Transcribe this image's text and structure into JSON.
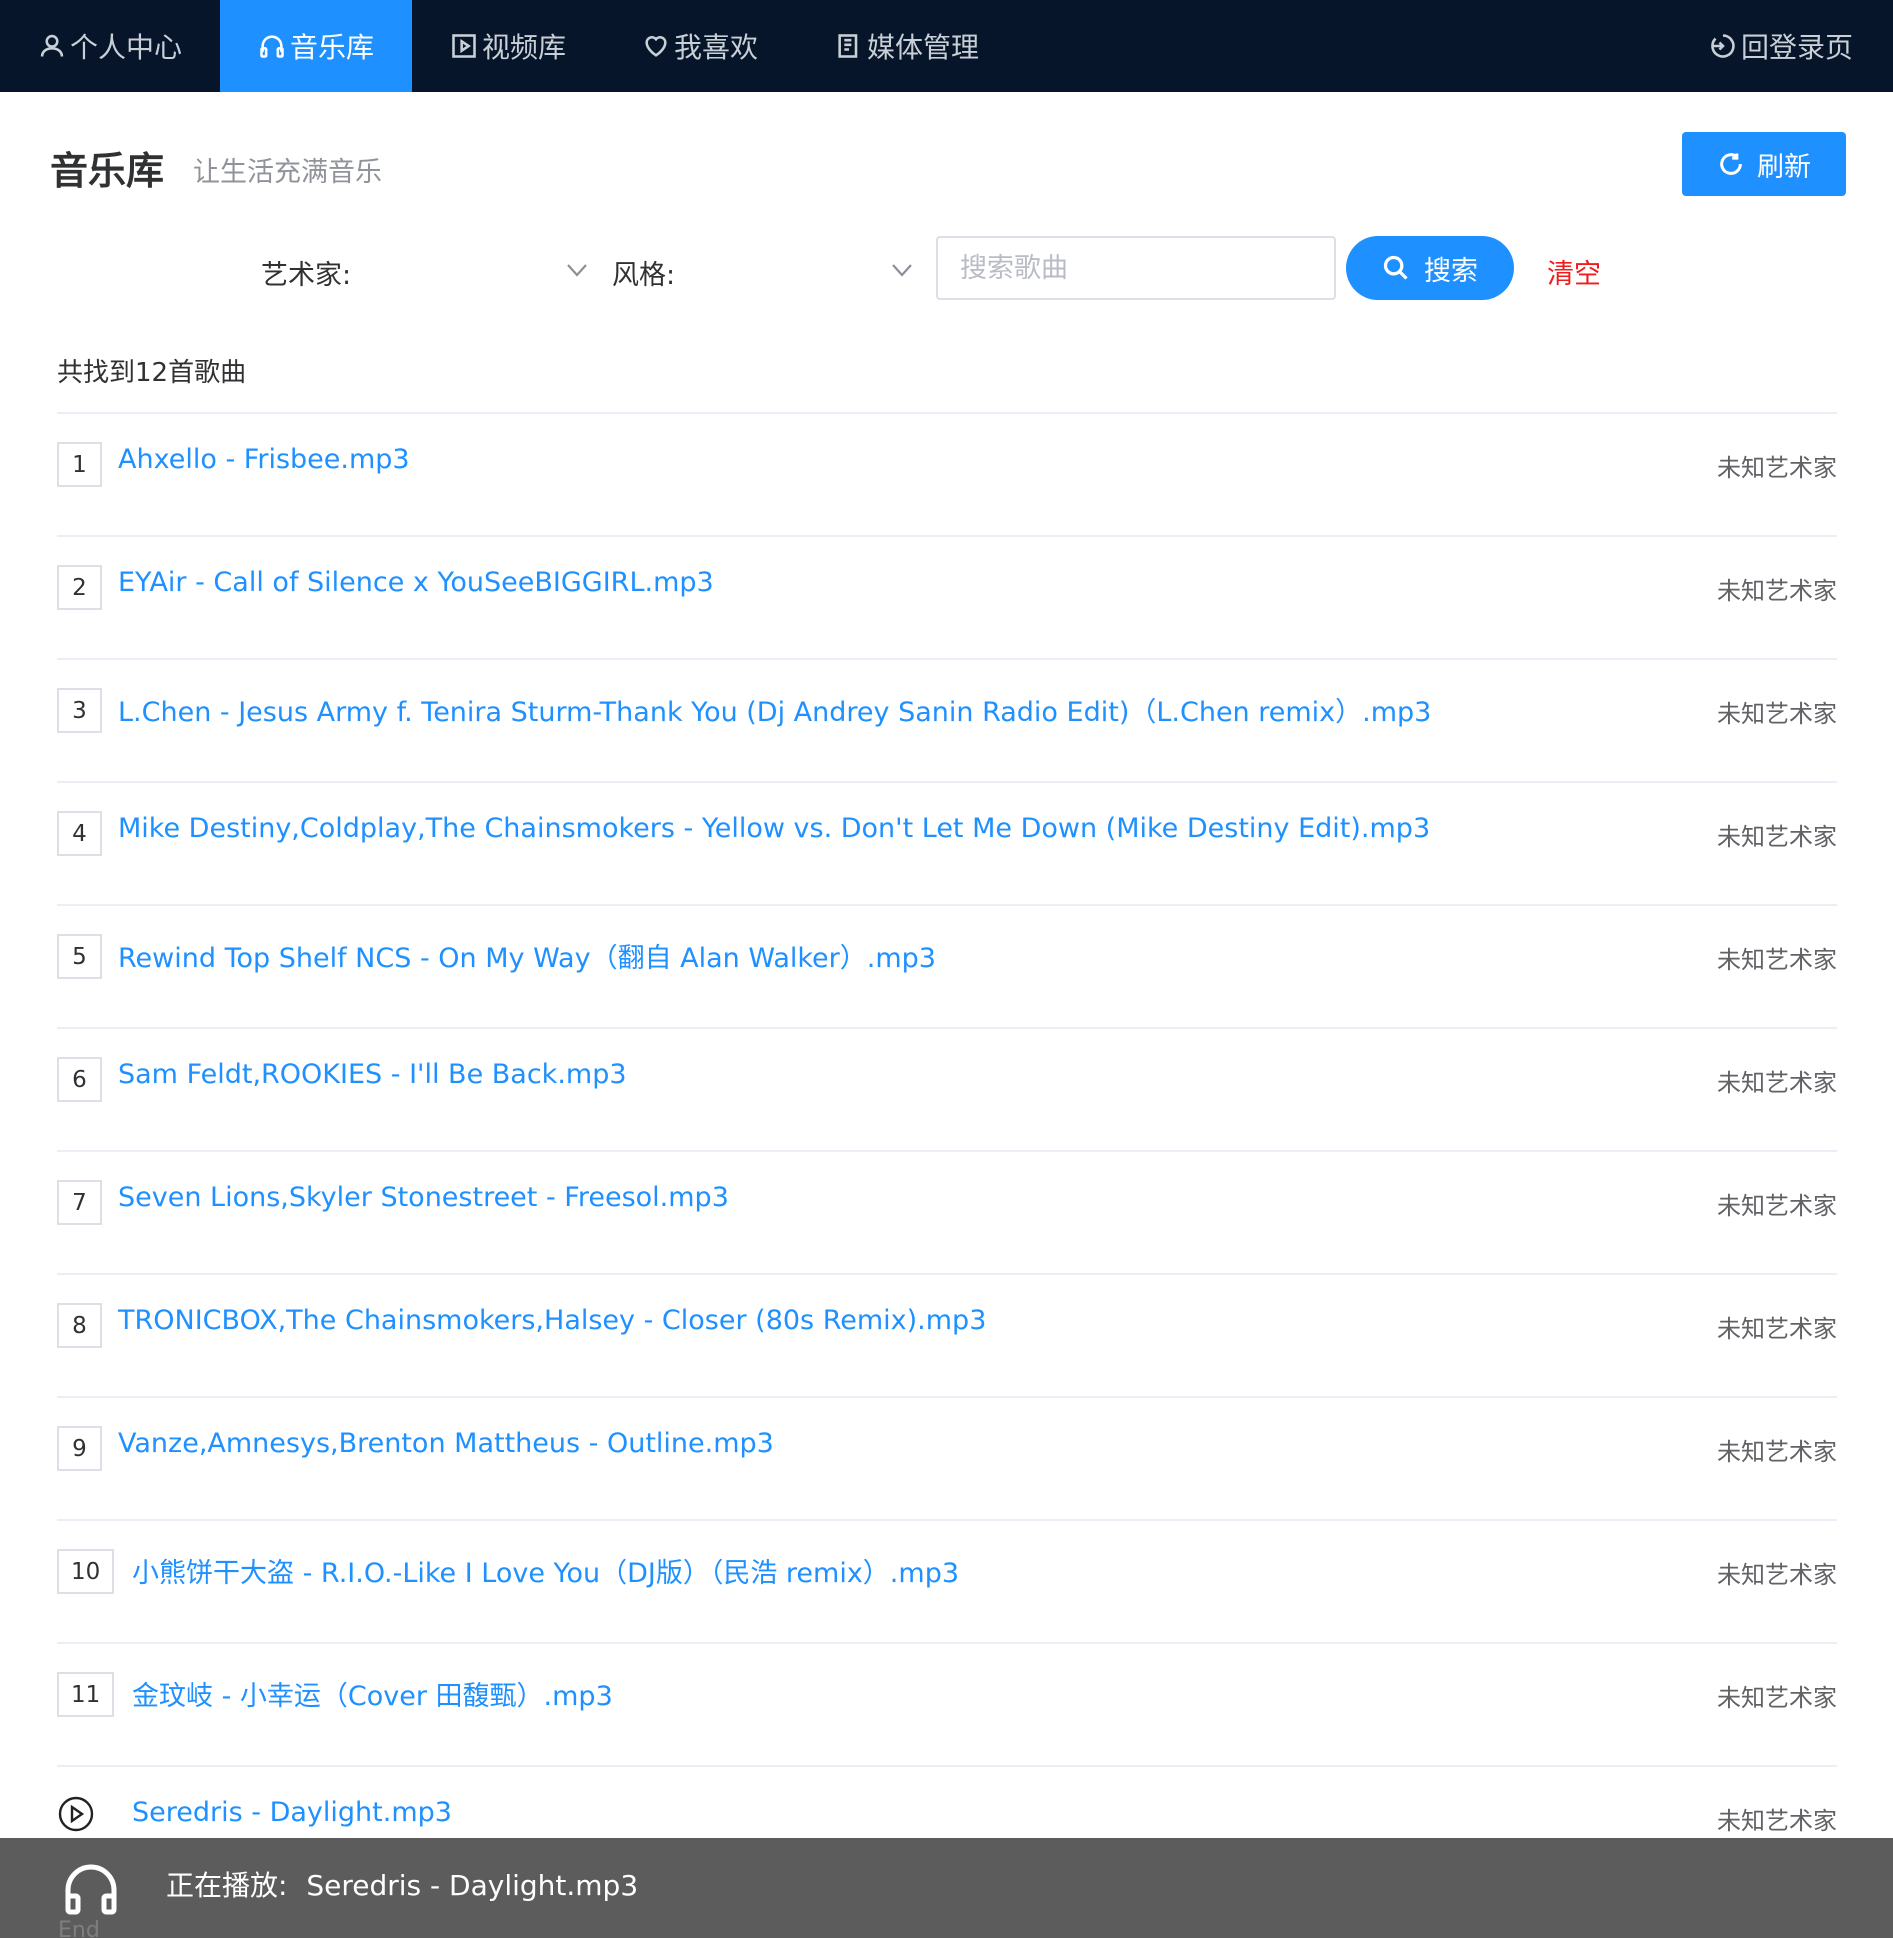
{
  "nav": {
    "items": [
      {
        "label": "个人中心",
        "icon": "user-icon"
      },
      {
        "label": "音乐库",
        "icon": "headphones-icon",
        "active": true
      },
      {
        "label": "视频库",
        "icon": "video-icon"
      },
      {
        "label": "我喜欢",
        "icon": "heart-icon"
      },
      {
        "label": "媒体管理",
        "icon": "media-icon"
      }
    ],
    "logout": "回登录页"
  },
  "header": {
    "title": "音乐库",
    "subtitle": "让生活充满音乐",
    "refresh_label": "刷新"
  },
  "filters": {
    "artist_label": "艺术家:",
    "style_label": "风格:",
    "search_placeholder": "搜索歌曲",
    "search_label": "搜索",
    "clear_label": "清空"
  },
  "result_count": "共找到12首歌曲",
  "songs": [
    {
      "no": "1",
      "title": "Ahxello - Frisbee.mp3",
      "artist": "未知艺术家"
    },
    {
      "no": "2",
      "title": "EYAir - Call of Silence x YouSeeBIGGIRL.mp3",
      "artist": "未知艺术家"
    },
    {
      "no": "3",
      "title": "L.Chen - Jesus Army f. Tenira Sturm-Thank You (Dj Andrey Sanin Radio Edit)（L.Chen remix）.mp3",
      "artist": "未知艺术家"
    },
    {
      "no": "4",
      "title": "Mike Destiny,Coldplay,The Chainsmokers - Yellow vs. Don't Let Me Down (Mike Destiny Edit).mp3",
      "artist": "未知艺术家"
    },
    {
      "no": "5",
      "title": "Rewind Top Shelf NCS - On My Way（翻自 Alan Walker）.mp3",
      "artist": "未知艺术家"
    },
    {
      "no": "6",
      "title": "Sam Feldt,ROOKIES - I'll Be Back.mp3",
      "artist": "未知艺术家"
    },
    {
      "no": "7",
      "title": "Seven Lions,Skyler Stonestreet - Freesol.mp3",
      "artist": "未知艺术家"
    },
    {
      "no": "8",
      "title": "TRONICBOX,The Chainsmokers,Halsey - Closer (80s Remix).mp3",
      "artist": "未知艺术家"
    },
    {
      "no": "9",
      "title": "Vanze,Amnesys,Brenton Mattheus - Outline.mp3",
      "artist": "未知艺术家"
    },
    {
      "no": "10",
      "title": "小熊饼干大盗 - R.I.O.-Like I Love You（DJ版）（民浩 remix）.mp3",
      "artist": "未知艺术家"
    },
    {
      "no": "11",
      "title": "金玟岐 - 小幸运（Cover 田馥甄）.mp3",
      "artist": "未知艺术家"
    },
    {
      "no": "",
      "title": "Seredris - Daylight.mp3",
      "artist": "未知艺术家",
      "playing": true
    }
  ],
  "player": {
    "now_playing_label": "正在播放:",
    "now_playing_title": "Seredris - Daylight.mp3",
    "peek_text": "End"
  }
}
